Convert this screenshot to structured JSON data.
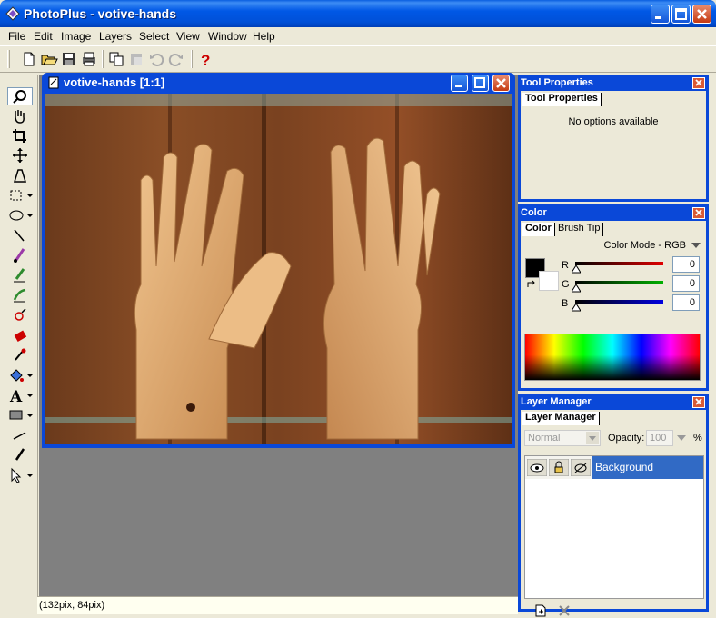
{
  "window": {
    "title": "PhotoPlus - votive-hands"
  },
  "menu": [
    "File",
    "Edit",
    "Image",
    "Layers",
    "Select",
    "View",
    "Window",
    "Help"
  ],
  "document": {
    "title": "votive-hands [1:1]"
  },
  "status": {
    "coords": "(132pix, 84pix)"
  },
  "tool_properties": {
    "panel_title": "Tool Properties",
    "tab": "Tool Properties",
    "message": "No options available"
  },
  "color_panel": {
    "panel_title": "Color",
    "tabs": [
      "Color",
      "Brush Tip"
    ],
    "mode_label": "Color Mode - RGB",
    "channels": [
      {
        "label": "R",
        "value": "0",
        "color": "#E00000"
      },
      {
        "label": "G",
        "value": "0",
        "color": "#00B000"
      },
      {
        "label": "B",
        "value": "0",
        "color": "#0000E0"
      }
    ],
    "foreground": "#000000",
    "background": "#FFFFFF"
  },
  "layer_manager": {
    "panel_title": "Layer Manager",
    "tab": "Layer Manager",
    "blend_mode": "Normal",
    "opacity_label": "Opacity:",
    "opacity_value": "100",
    "percent": "%",
    "layers": [
      {
        "name": "Background"
      }
    ]
  }
}
